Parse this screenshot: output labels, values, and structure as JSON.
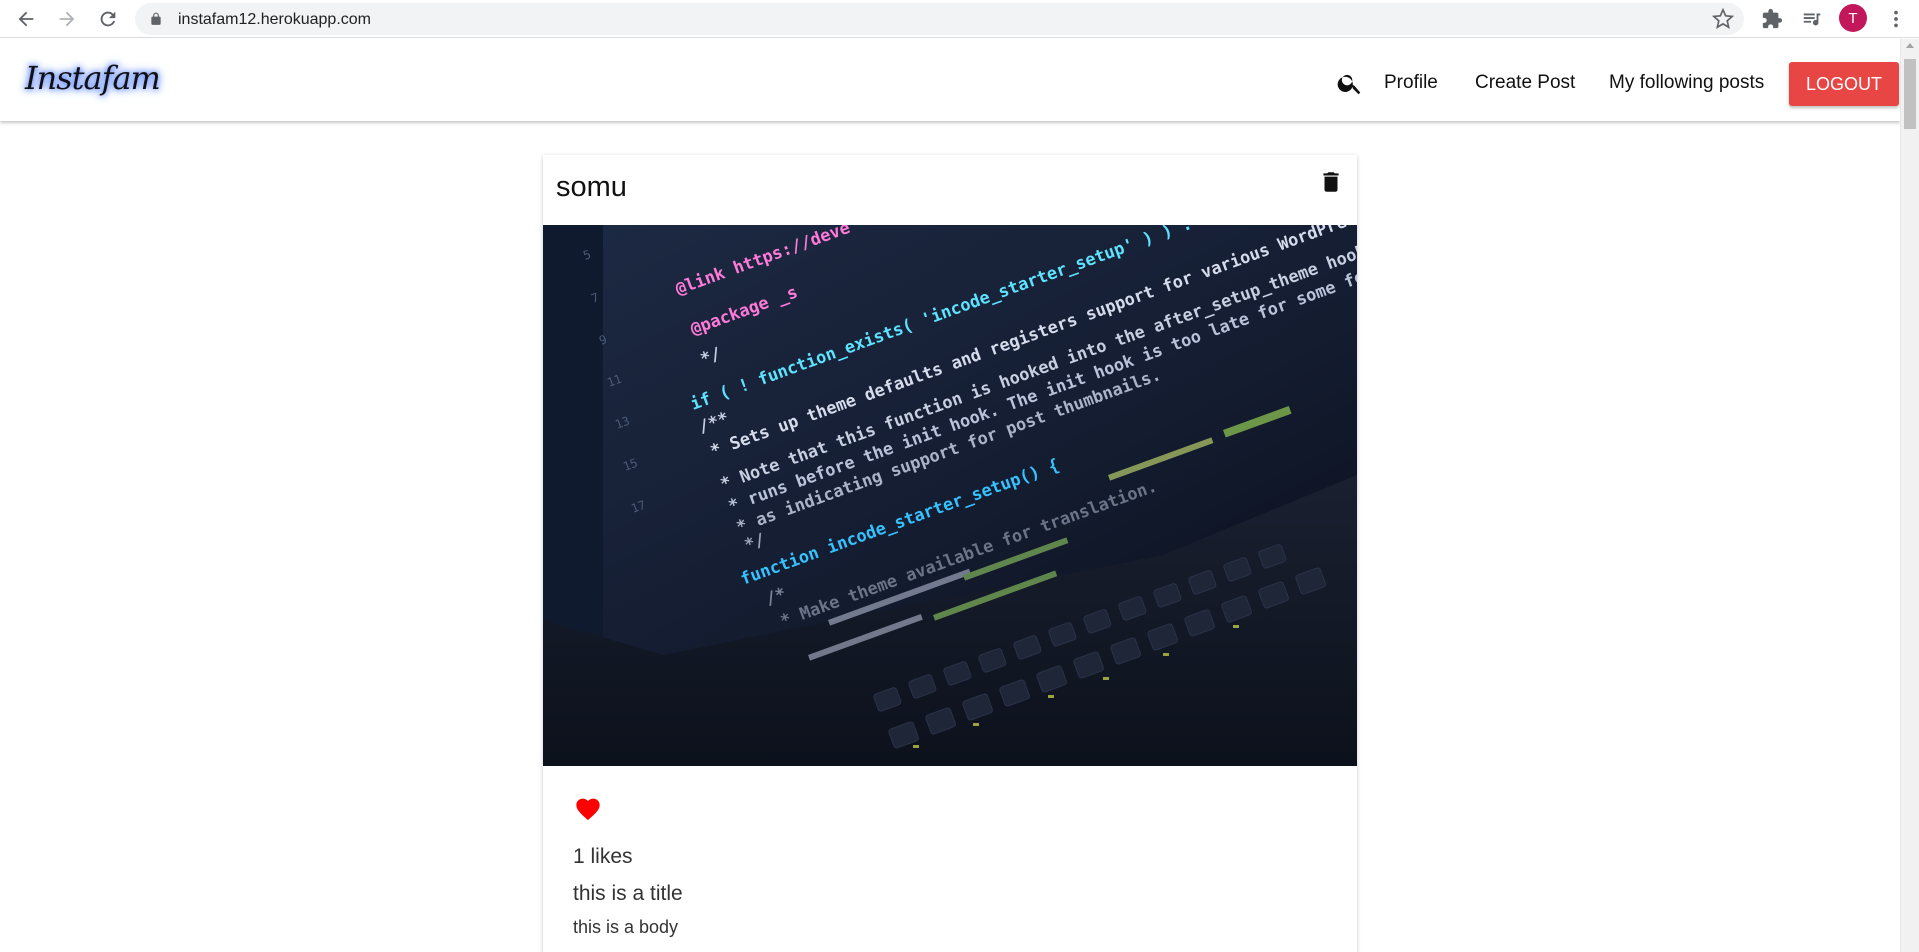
{
  "browser": {
    "url": "instafam12.herokuapp.com",
    "profile_initial": "T",
    "accent_color": "#c2185b"
  },
  "appbar": {
    "brand": "Instafam",
    "nav_links": [
      "Profile",
      "Create Post",
      "My following posts"
    ],
    "logout_label": "LOGOUT",
    "logout_color": "#e84545"
  },
  "post": {
    "author": "somu",
    "image_alt_icon": "code-on-laptop-photo",
    "code_lines": [
      "@link https://deve",
      "@package _s",
      "*/",
      "if ( ! function_exists( 'incode_starter_setup' ) ) :",
      "/**",
      " * Sets up theme defaults and registers support for various WordPress fea",
      " * Note that this function is hooked into the after_setup_theme hook, which",
      " * runs before the init hook. The init hook is too late for some features, such",
      " * as indicating support for post thumbnails.",
      " */",
      "function incode_starter_setup() {",
      "/*",
      " * Make theme available for translation."
    ],
    "liked": true,
    "like_color": "#ff0000",
    "likes": "1 likes",
    "title": "this is a title",
    "body": "this is a body"
  }
}
